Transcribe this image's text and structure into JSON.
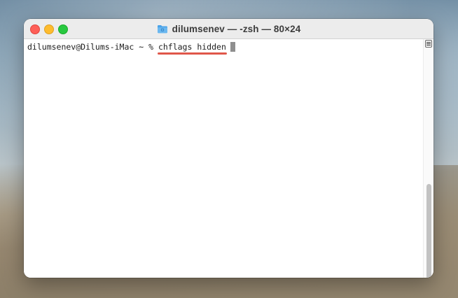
{
  "window": {
    "title": "dilumsenev — -zsh — 80×24",
    "title_icon": "folder-icon",
    "controls": [
      "close-button",
      "minimize-button",
      "zoom-button"
    ]
  },
  "terminal": {
    "prompt": "dilumsenev@Dilums-iMac ~ % ",
    "command": "chflags hidden",
    "highlight_color": "#e0574a"
  },
  "scrollbar": {
    "menu_icon": "lines-icon"
  },
  "colors": {
    "close": "#fe5f57",
    "minimize": "#febc2e",
    "zoom": "#28c840",
    "folder": "#4aa3e8"
  }
}
